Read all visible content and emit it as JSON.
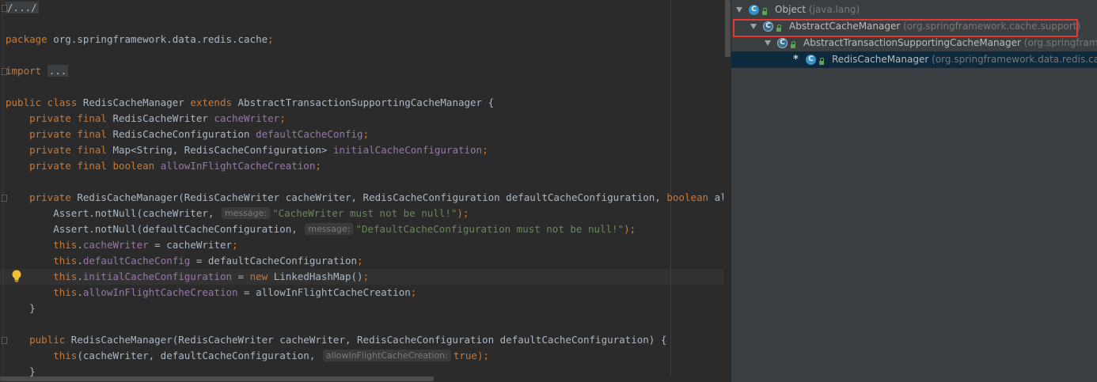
{
  "editor": {
    "lines": [
      {
        "tokens": [
          {
            "t": "/.../",
            "c": "fold-box"
          }
        ]
      },
      {
        "tokens": []
      },
      {
        "tokens": [
          {
            "t": "package",
            "c": "kw"
          },
          {
            "t": " org.springframework.data.redis.cache"
          },
          {
            "t": ";",
            "c": "kw"
          }
        ]
      },
      {
        "tokens": []
      },
      {
        "tokens": [
          {
            "t": "import",
            "c": "kw"
          },
          {
            "t": " "
          },
          {
            "t": "...",
            "c": "fold-box"
          }
        ]
      },
      {
        "tokens": []
      },
      {
        "tokens": [
          {
            "t": "public class",
            "c": "kw"
          },
          {
            "t": " RedisCacheManager "
          },
          {
            "t": "extends",
            "c": "kw"
          },
          {
            "t": " AbstractTransactionSupportingCacheManager {"
          }
        ]
      },
      {
        "tokens": [
          {
            "t": "    "
          },
          {
            "t": "private final",
            "c": "kw"
          },
          {
            "t": " RedisCacheWriter "
          },
          {
            "t": "cacheWriter",
            "c": "fld"
          },
          {
            "t": ";",
            "c": "kw"
          }
        ]
      },
      {
        "tokens": [
          {
            "t": "    "
          },
          {
            "t": "private final",
            "c": "kw"
          },
          {
            "t": " RedisCacheConfiguration "
          },
          {
            "t": "defaultCacheConfig",
            "c": "fld"
          },
          {
            "t": ";",
            "c": "kw"
          }
        ]
      },
      {
        "tokens": [
          {
            "t": "    "
          },
          {
            "t": "private final",
            "c": "kw"
          },
          {
            "t": " Map<String, RedisCacheConfiguration> "
          },
          {
            "t": "initialCacheConfiguration",
            "c": "fld"
          },
          {
            "t": ";",
            "c": "kw"
          }
        ]
      },
      {
        "tokens": [
          {
            "t": "    "
          },
          {
            "t": "private final boolean",
            "c": "kw"
          },
          {
            "t": " "
          },
          {
            "t": "allowInFlightCacheCreation",
            "c": "fld"
          },
          {
            "t": ";",
            "c": "kw"
          }
        ]
      },
      {
        "tokens": []
      },
      {
        "tokens": [
          {
            "t": "    "
          },
          {
            "t": "private",
            "c": "kw"
          },
          {
            "t": " RedisCacheManager(RedisCacheWriter cacheWriter, RedisCacheConfiguration defaultCacheConfiguration, "
          },
          {
            "t": "boolean",
            "c": "kw"
          },
          {
            "t": " allowInFligh"
          }
        ]
      },
      {
        "tokens": [
          {
            "t": "        Assert.notNull(cacheWriter, "
          },
          {
            "t": "message:",
            "c": "hint"
          },
          {
            "t": "\"CacheWriter must not be null!\"",
            "c": "str"
          },
          {
            "t": ");",
            "c": "kw"
          }
        ]
      },
      {
        "tokens": [
          {
            "t": "        Assert.notNull(defaultCacheConfiguration, "
          },
          {
            "t": "message:",
            "c": "hint"
          },
          {
            "t": "\"DefaultCacheConfiguration must not be null!\"",
            "c": "str"
          },
          {
            "t": ");",
            "c": "kw"
          }
        ]
      },
      {
        "tokens": [
          {
            "t": "        "
          },
          {
            "t": "this",
            "c": "kw"
          },
          {
            "t": "."
          },
          {
            "t": "cacheWriter",
            "c": "fld"
          },
          {
            "t": " = cacheWriter"
          },
          {
            "t": ";",
            "c": "kw"
          }
        ]
      },
      {
        "tokens": [
          {
            "t": "        "
          },
          {
            "t": "this",
            "c": "kw"
          },
          {
            "t": "."
          },
          {
            "t": "defaultCacheConfig",
            "c": "fld"
          },
          {
            "t": " = defaultCacheConfiguration"
          },
          {
            "t": ";",
            "c": "kw"
          }
        ]
      },
      {
        "tokens": [
          {
            "t": "        "
          },
          {
            "t": "this",
            "c": "kw"
          },
          {
            "t": "."
          },
          {
            "t": "initialCacheConfiguration",
            "c": "fld"
          },
          {
            "t": " = "
          },
          {
            "t": "new",
            "c": "kw"
          },
          {
            "t": " LinkedHashMap()"
          },
          {
            "t": ";",
            "c": "kw"
          }
        ]
      },
      {
        "tokens": [
          {
            "t": "        "
          },
          {
            "t": "this",
            "c": "kw"
          },
          {
            "t": "."
          },
          {
            "t": "allowInFlightCacheCreation",
            "c": "fld"
          },
          {
            "t": " = allowInFlightCacheCreation"
          },
          {
            "t": ";",
            "c": "kw"
          }
        ]
      },
      {
        "tokens": [
          {
            "t": "    }"
          }
        ]
      },
      {
        "tokens": []
      },
      {
        "tokens": [
          {
            "t": "    "
          },
          {
            "t": "public",
            "c": "kw"
          },
          {
            "t": " RedisCacheManager(RedisCacheWriter cacheWriter, RedisCacheConfiguration defaultCacheConfiguration) {"
          }
        ]
      },
      {
        "tokens": [
          {
            "t": "        "
          },
          {
            "t": "this",
            "c": "kw"
          },
          {
            "t": "(cacheWriter, defaultCacheConfiguration, "
          },
          {
            "t": "allowInFlightCacheCreation:",
            "c": "hint"
          },
          {
            "t": "true",
            "c": "kw"
          },
          {
            "t": ");",
            "c": "kw"
          }
        ]
      },
      {
        "tokens": [
          {
            "t": "    }"
          }
        ]
      }
    ]
  },
  "hierarchy": {
    "rows": [
      {
        "name": "Object",
        "package": "(java.lang)",
        "icon": "class-icon",
        "expanded": true,
        "selected": false,
        "current": false
      },
      {
        "name": "AbstractCacheManager",
        "package": "(org.springframework.cache.support)",
        "icon": "abstract-class-icon",
        "expanded": true,
        "selected": false,
        "current": false
      },
      {
        "name": "AbstractTransactionSupportingCacheManager",
        "package": "(org.springframe",
        "icon": "abstract-class-icon",
        "expanded": true,
        "selected": false,
        "current": false
      },
      {
        "name": "RedisCacheManager",
        "package": "(org.springframework.data.redis.cach",
        "icon": "class-icon",
        "expanded": false,
        "selected": true,
        "current": true
      }
    ],
    "current_marker": "*",
    "icon_letter": "C",
    "highlight_color": "#e53935"
  }
}
